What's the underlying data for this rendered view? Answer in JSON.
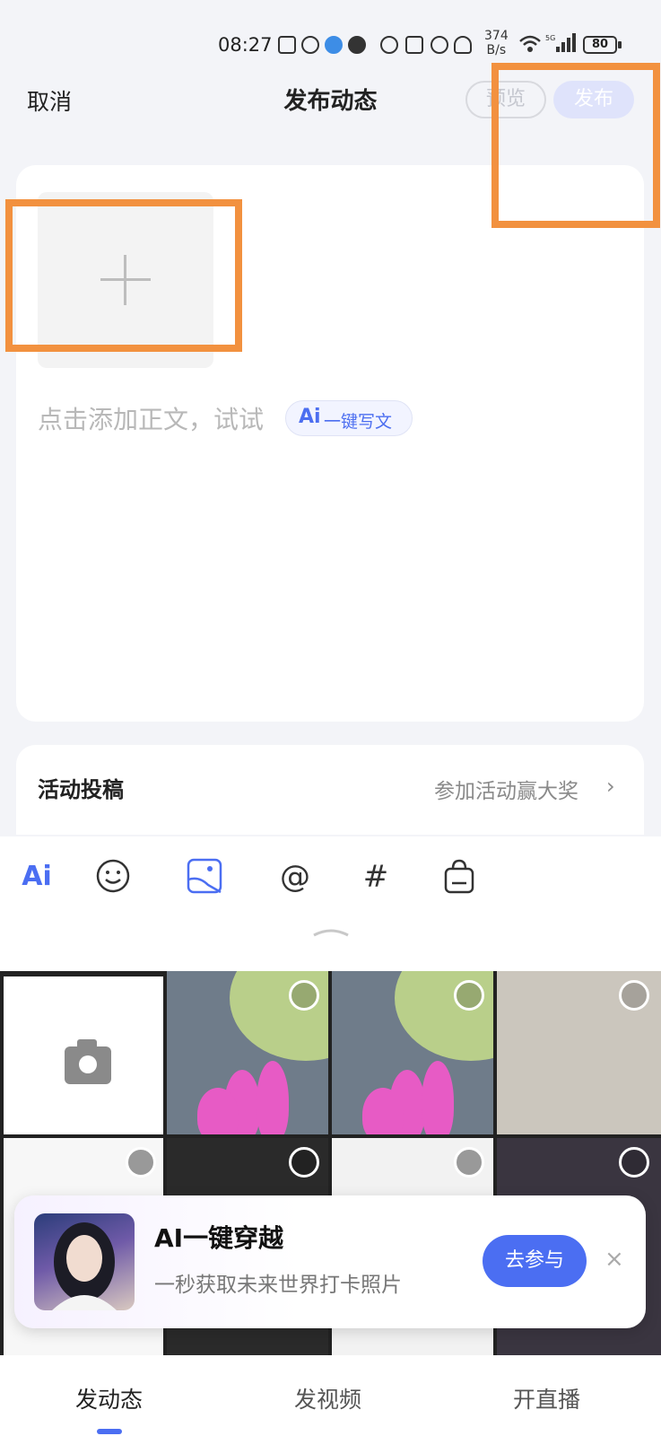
{
  "status_bar": {
    "time": "08:27",
    "net_rate_value": "374",
    "net_rate_unit": "B/s",
    "battery": "80"
  },
  "header": {
    "cancel_label": "取消",
    "title": "发布动态",
    "preview_label": "预览",
    "publish_label": "发布"
  },
  "compose": {
    "placeholder": "点击添加正文，试试",
    "ai_write_mark": "Ai",
    "ai_write_label": "一键写文"
  },
  "activity": {
    "title": "活动投稿",
    "link": "参加活动赢大奖",
    "chevron": "›"
  },
  "toolbar": {
    "ai_label": "Ai",
    "mention_label": "@",
    "topic_label": "#"
  },
  "promo": {
    "title": "AI一键穿越",
    "subtitle": "一秒获取未来世界打卡照片",
    "button_label": "去参与",
    "close_label": "×"
  },
  "tabs": [
    {
      "label": "发动态",
      "active": true
    },
    {
      "label": "发视频",
      "active": false
    },
    {
      "label": "开直播",
      "active": false
    }
  ],
  "colors": {
    "accent": "#4b6ef2",
    "annotation": "#f2913f"
  },
  "icons": [
    "upload-icon",
    "wechat-icon",
    "browser-icon",
    "message-icon",
    "nfc-icon",
    "alarm-icon",
    "mute-icon",
    "wifi-icon",
    "signal-icon",
    "battery-icon",
    "emoji-icon",
    "image-icon",
    "bag-icon",
    "camera-icon",
    "plus-icon",
    "chevron-right-icon",
    "close-icon"
  ]
}
